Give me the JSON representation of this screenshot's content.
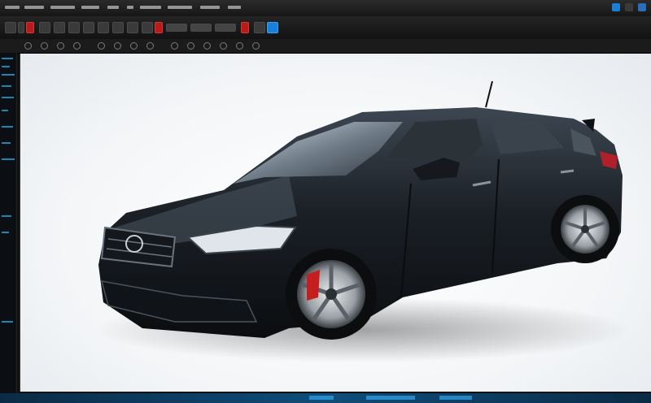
{
  "app": {
    "status_text": ""
  },
  "colors": {
    "accent": "#1a7fd6",
    "car_body": "#1b2026",
    "brake_caliper": "#c41e1e",
    "viewport_bg": "#f4f6f8"
  },
  "icons": {
    "window_controls": [
      "minimize-icon",
      "maximize-icon",
      "close-icon"
    ],
    "toolbar": [
      "settings-icon",
      "record-icon",
      "brush-icon",
      "select-icon",
      "render-icon",
      "save-icon"
    ]
  }
}
